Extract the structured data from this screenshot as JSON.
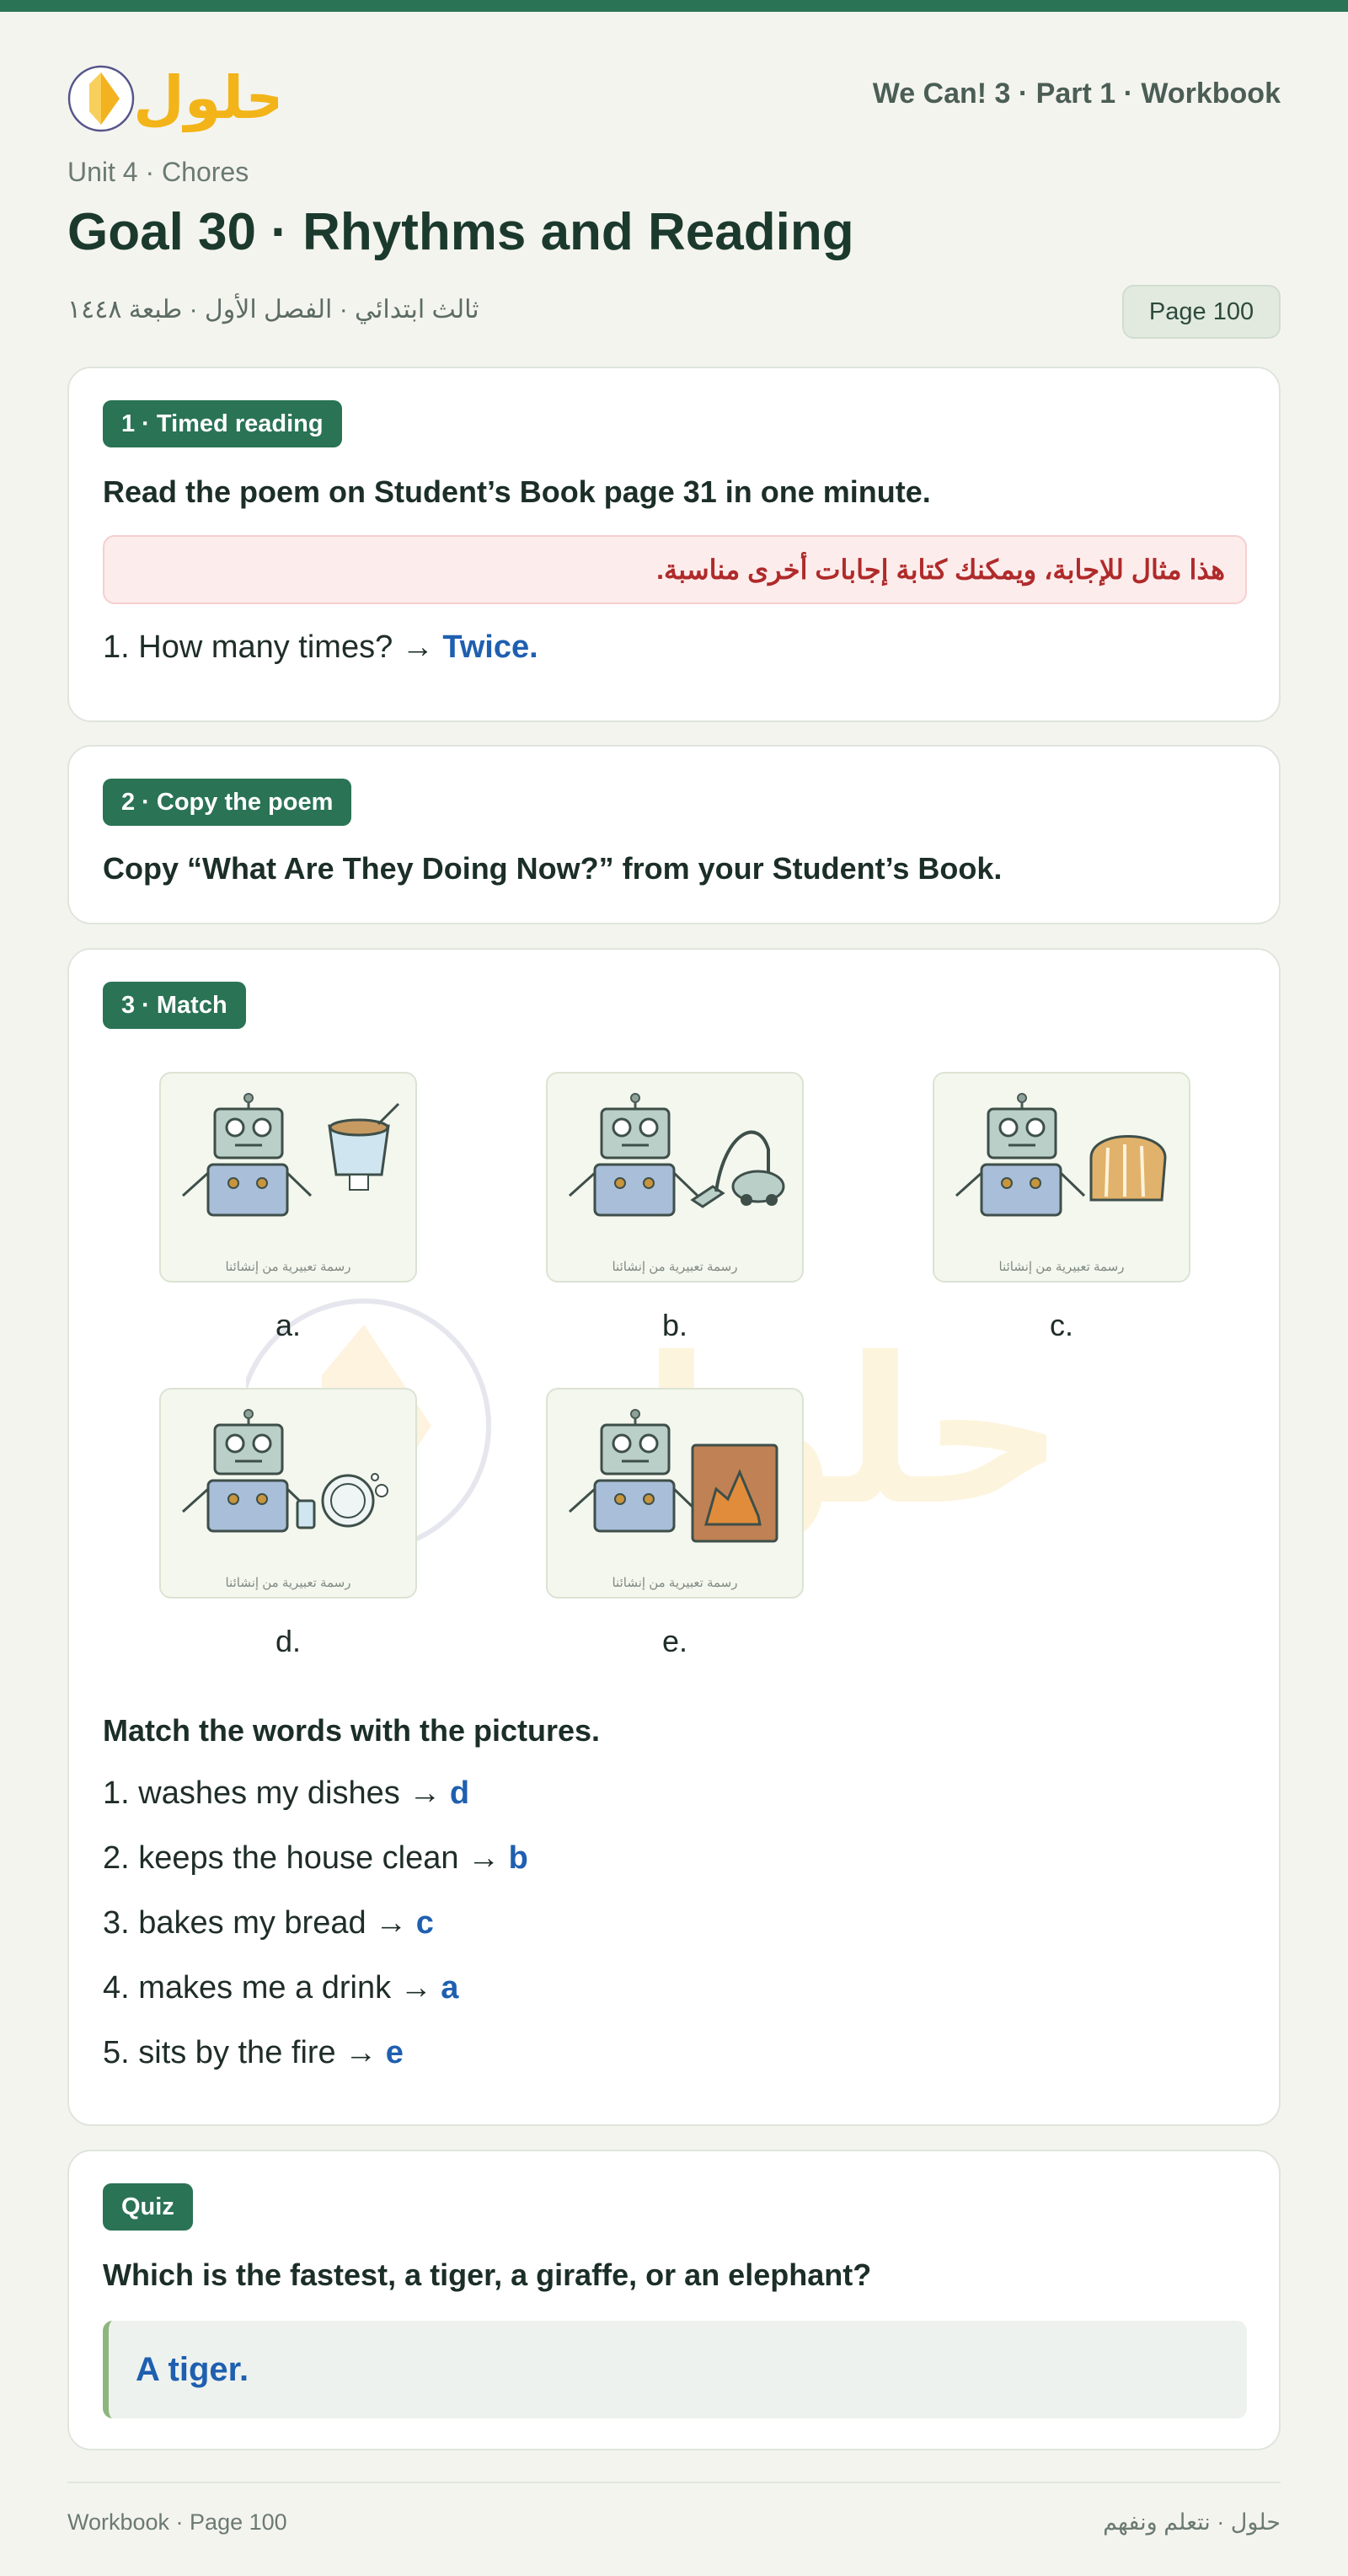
{
  "header": {
    "logo_text": "حلول",
    "book_title": "We Can! 3 · Part 1 · Workbook",
    "unit": "Unit 4 · Chores",
    "goal": "Goal 30 · Rhythms and Reading",
    "meta_ar": "ثالث ابتدائي · الفصل الأول · طبعة ١٤٤٨",
    "page_badge": "Page 100"
  },
  "section1": {
    "pill": "1 · Timed reading",
    "instruction": "Read the poem on Student’s Book page 31 in one minute.",
    "note": "هذا مثال للإجابة، ويمكنك كتابة إجابات أخرى مناسبة.",
    "question": "1. How many times? →",
    "answer": "Twice."
  },
  "section2": {
    "pill": "2 · Copy the poem",
    "instruction": "Copy “What Are They Doing Now?” from your Student’s Book."
  },
  "section3": {
    "pill": "3 · Match",
    "picture_caption": "رسمة تعبيرية من إنشائنا",
    "pictures": [
      {
        "label": "a.",
        "object": "drink-cup"
      },
      {
        "label": "b.",
        "object": "vacuum-cleaner"
      },
      {
        "label": "c.",
        "object": "bread-loaf"
      },
      {
        "label": "d.",
        "object": "dishes"
      },
      {
        "label": "e.",
        "object": "fireplace"
      }
    ],
    "instruction": "Match the words with the pictures.",
    "items": [
      {
        "text": "1. washes my dishes →",
        "answer": "d"
      },
      {
        "text": "2. keeps the house clean →",
        "answer": "b"
      },
      {
        "text": "3. bakes my bread →",
        "answer": "c"
      },
      {
        "text": "4. makes me a drink →",
        "answer": "a"
      },
      {
        "text": "5. sits by the fire →",
        "answer": "e"
      }
    ]
  },
  "quiz": {
    "pill": "Quiz",
    "question": "Which is the fastest, a tiger, a giraffe, or an elephant?",
    "answer": "A tiger."
  },
  "footer": {
    "left": "Workbook · Page 100",
    "right": "حلول · نتعلم ونفهم"
  },
  "colors": {
    "accent": "#2a7355",
    "answer": "#1f5fb0",
    "note_text": "#b02a2a",
    "background": "#f4f4ef"
  }
}
